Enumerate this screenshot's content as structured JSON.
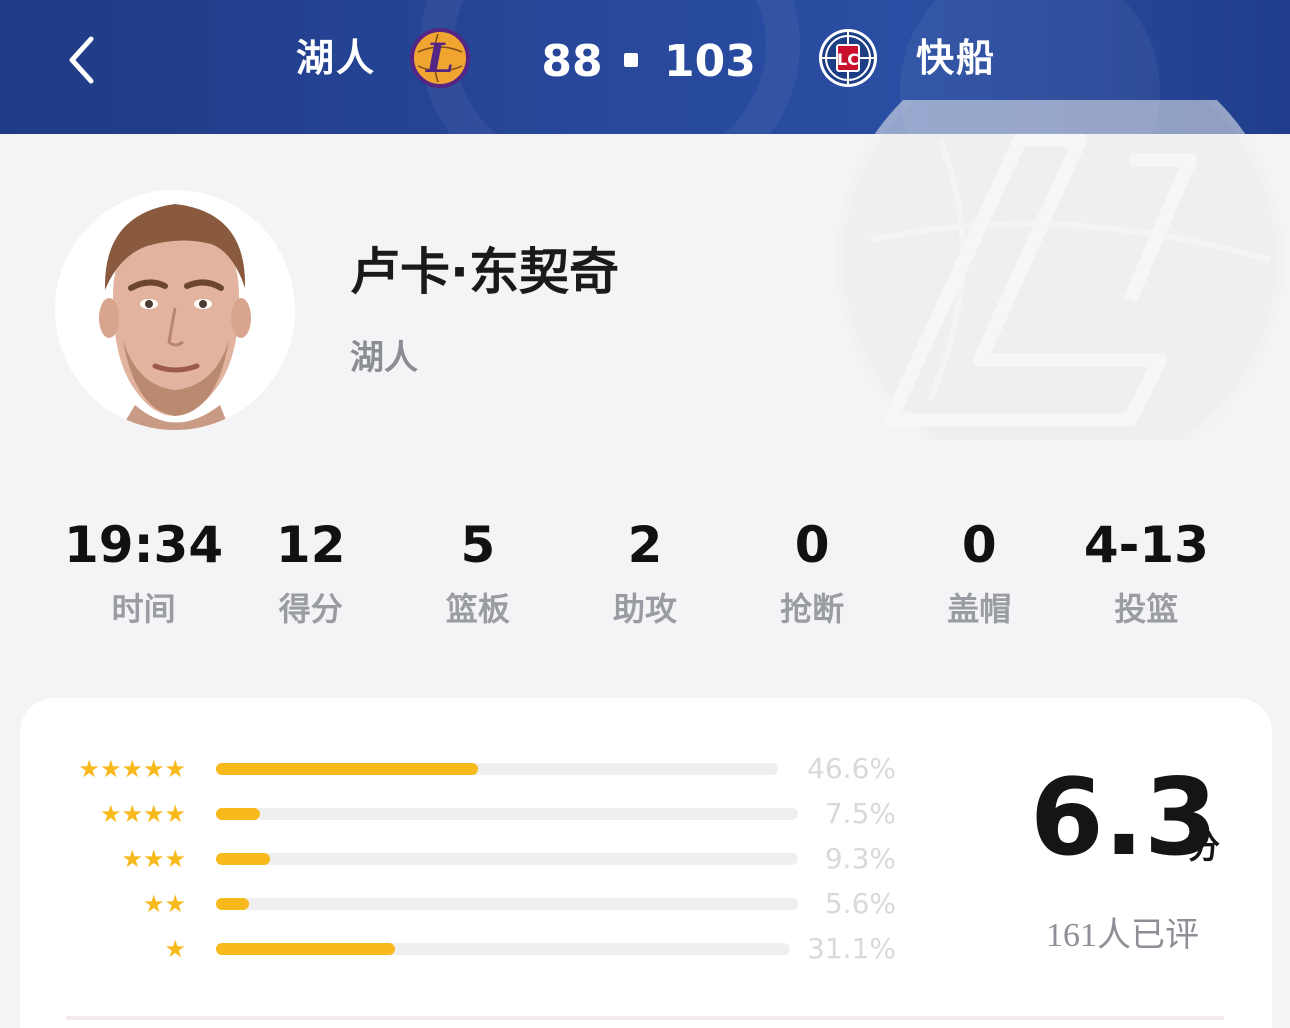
{
  "header": {
    "back_icon": "chevron-left-icon",
    "home_team": {
      "name": "湖人",
      "score": "88",
      "logo": "lakers-logo",
      "color": "#552583",
      "accent": "#FDB927"
    },
    "away_team": {
      "name": "快船",
      "score": "103",
      "logo": "clippers-logo",
      "color": "#C8102E",
      "accent": "#1D428A"
    },
    "background": "#27479a"
  },
  "player": {
    "name": "卢卡·东契奇",
    "team": "湖人",
    "avatar": "player-photo"
  },
  "stats": [
    {
      "value": "19:34",
      "label": "时间"
    },
    {
      "value": "12",
      "label": "得分"
    },
    {
      "value": "5",
      "label": "篮板"
    },
    {
      "value": "2",
      "label": "助攻"
    },
    {
      "value": "0",
      "label": "抢断"
    },
    {
      "value": "0",
      "label": "盖帽"
    },
    {
      "value": "4-13",
      "label": "投篮"
    }
  ],
  "rating": {
    "score": "6.3",
    "unit": "分",
    "raters": "161人已评",
    "accent": "#f8b91c",
    "distribution": [
      {
        "stars": 5,
        "percent_text": "46.6%",
        "percent": 46.6
      },
      {
        "stars": 4,
        "percent_text": "7.5%",
        "percent": 7.5
      },
      {
        "stars": 3,
        "percent_text": "9.3%",
        "percent": 9.3
      },
      {
        "stars": 2,
        "percent_text": "5.6%",
        "percent": 5.6
      },
      {
        "stars": 1,
        "percent_text": "31.1%",
        "percent": 31.1
      }
    ]
  }
}
